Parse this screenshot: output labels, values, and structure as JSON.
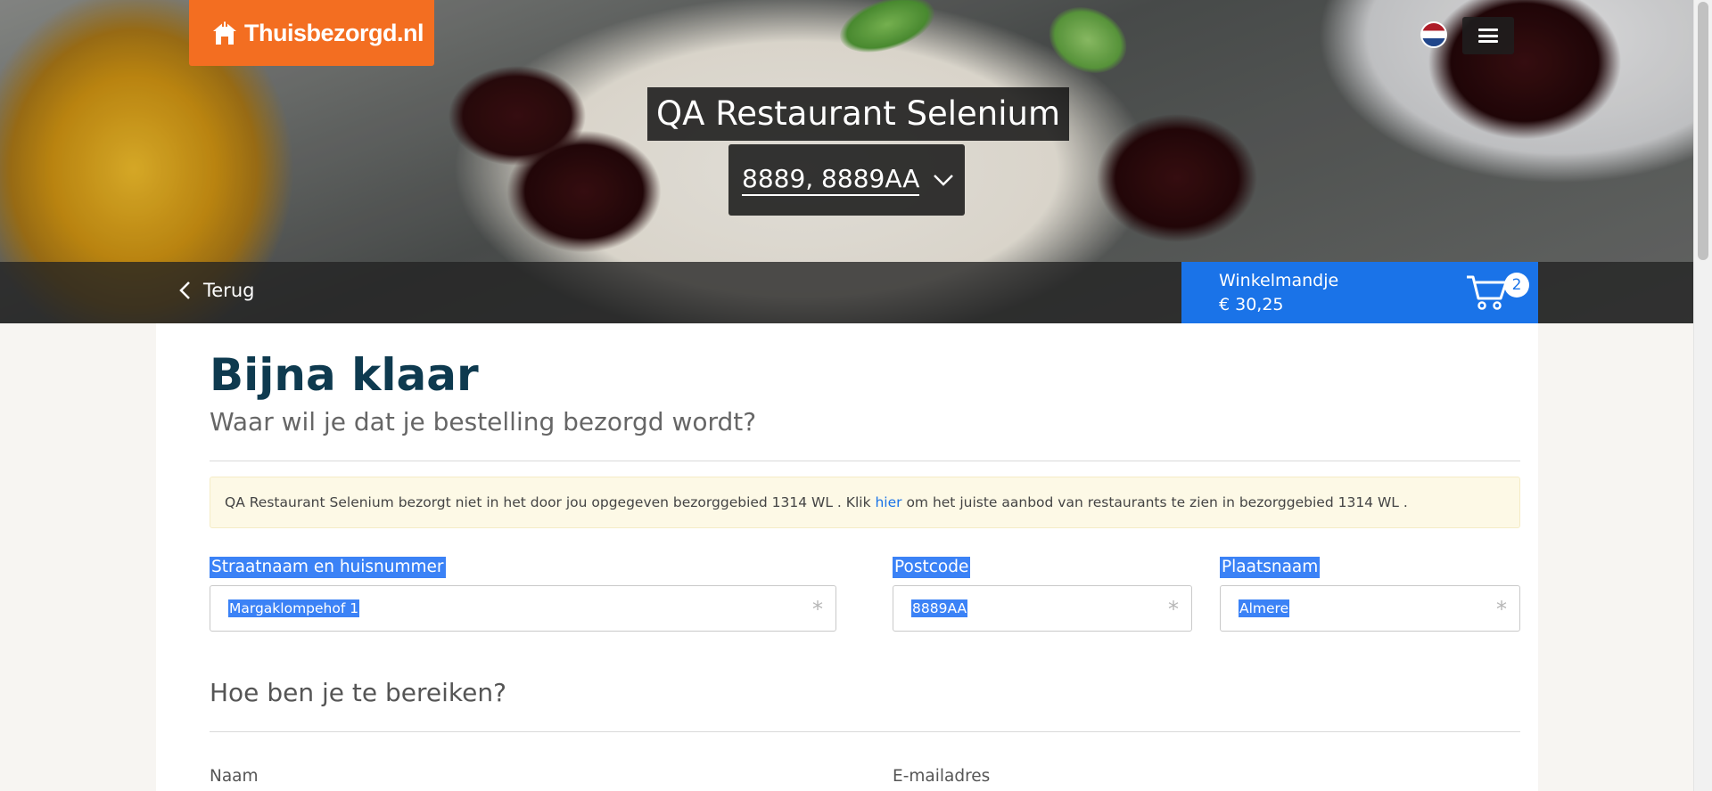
{
  "header": {
    "logo_text": "Thuisbezorgd.nl",
    "brand_color": "#f36e21",
    "language_flag": "Dutch flag",
    "menu_icon": "hamburger-icon",
    "restaurant_name": "QA Restaurant Selenium",
    "delivery_address": "8889, 8889AA",
    "back_label": "Terug"
  },
  "cart": {
    "label": "Winkelmandje",
    "total": "€ 30,25",
    "count": "2",
    "color": "#1a73e8"
  },
  "main": {
    "title": "Bijna klaar",
    "subtitle": "Waar wil je dat je bestelling bezorgd wordt?",
    "alert": {
      "text_before": "QA Restaurant Selenium bezorgt niet in het door jou opgegeven bezorggebied 1314 WL . Klik ",
      "link": "hier",
      "text_after": " om het juiste aanbod van restaurants te zien in bezorggebied 1314 WL ."
    },
    "address_fields": [
      {
        "label": "Straatnaam en huisnummer",
        "value": "Margaklompehof 1",
        "required_marker": "*"
      },
      {
        "label": "Postcode",
        "value": "8889AA",
        "required_marker": "*"
      },
      {
        "label": "Plaatsnaam",
        "value": "Almere",
        "required_marker": "*"
      }
    ],
    "contact_section": {
      "title": "Hoe ben je te bereiken?",
      "name_label": "Naam",
      "email_label": "E-mailadres"
    }
  },
  "colors": {
    "title_color": "#0e3a4f",
    "selection_highlight": "#3b82f6",
    "alert_background": "#fdf9e6"
  }
}
